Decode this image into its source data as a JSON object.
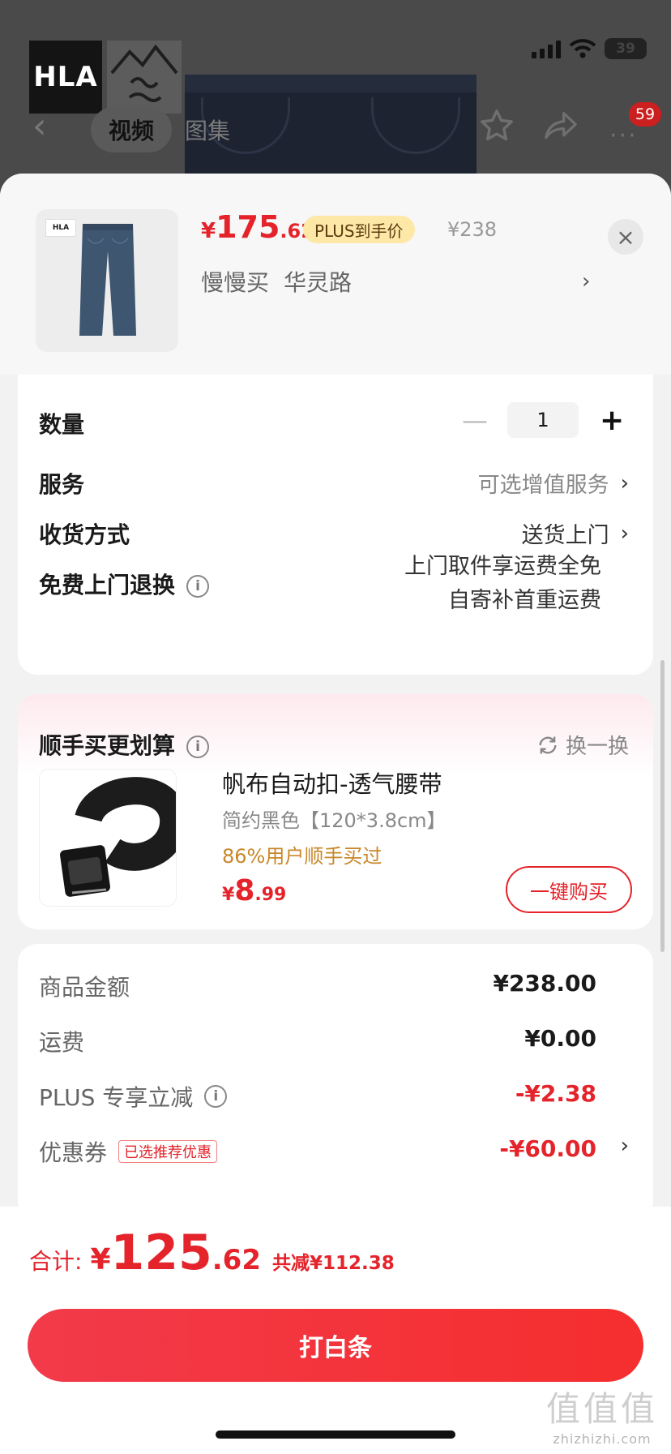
{
  "header": {
    "brand_letters": "HLA",
    "tabs": [
      "视频",
      "图集"
    ],
    "notification_count": "59",
    "battery": "39"
  },
  "product": {
    "price_currency": "¥",
    "price_int": "175",
    "price_dec": ".62",
    "plus_tag": "PLUS到手价",
    "original_price": "¥238",
    "spec_items": [
      "慢慢买",
      "华灵路"
    ]
  },
  "options": {
    "quantity_label": "数量",
    "quantity_value": "1",
    "service_label": "服务",
    "service_value": "可选增值服务",
    "delivery_label": "收货方式",
    "delivery_value": "送货上门",
    "return_label": "免费上门退换",
    "return_lines": [
      "上门取件享运费全免",
      "自寄补首重运费"
    ]
  },
  "addon": {
    "title": "顺手买更划算",
    "swap_label": "换一换",
    "name": "帆布自动扣-透气腰带",
    "spec": "简约黑色【120*3.8cm】",
    "bought": "86%用户顺手买过",
    "price_currency": "¥",
    "price_int": "8",
    "price_dec": ".99",
    "buy_label": "一键购买"
  },
  "summary": {
    "rows": [
      {
        "label": "商品金额",
        "value": "¥238.00"
      },
      {
        "label": "运费",
        "value": "¥0.00"
      },
      {
        "label": "PLUS 专享立减",
        "value": "-¥2.38"
      },
      {
        "label": "优惠券",
        "value": "-¥60.00",
        "tag": "已选推荐优惠"
      }
    ]
  },
  "footer": {
    "total_label": "合计:",
    "total_currency": "¥",
    "total_int": "125",
    "total_dec": ".62",
    "savings": "共减¥112.38",
    "pay_label": "打白条",
    "watermark": "值值值",
    "watermark_url": "zhizhizhi.com"
  },
  "colors": {
    "accent_red": "#e4232b",
    "plus_gold": "#fde8a8",
    "bought_orange": "#c8872a"
  },
  "icons": [
    "back-arrow-icon",
    "star-icon",
    "share-icon",
    "more-icon",
    "close-icon",
    "info-icon",
    "refresh-icon",
    "chevron-right-icon"
  ]
}
